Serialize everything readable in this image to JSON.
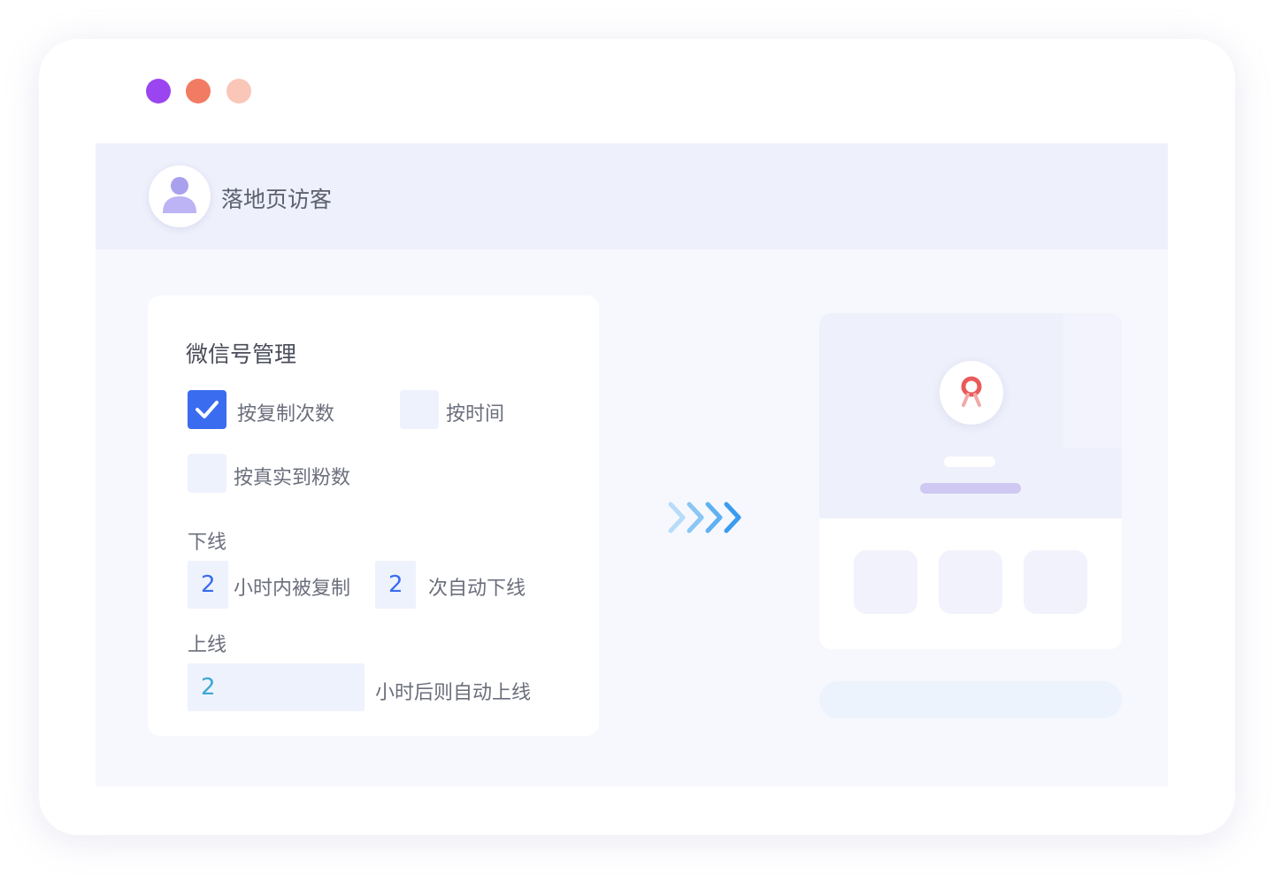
{
  "window": {
    "dots": [
      {
        "name": "dot-purple",
        "color": "#9b45f0"
      },
      {
        "name": "dot-coral",
        "color": "#f27b63"
      },
      {
        "name": "dot-peach",
        "color": "#f9c6b8"
      }
    ]
  },
  "header": {
    "title": "落地页访客",
    "avatar_icon": "user-icon"
  },
  "card": {
    "title": "微信号管理",
    "options": [
      {
        "label": "按复制次数",
        "checked": true
      },
      {
        "label": "按时间",
        "checked": false
      },
      {
        "label": "按真实到粉数",
        "checked": false
      }
    ],
    "offline": {
      "heading": "下线",
      "hours_value": "2",
      "hours_text": "小时内被复制",
      "times_value": "2",
      "times_text": "次自动下线"
    },
    "online": {
      "heading": "上线",
      "hours_value": "2",
      "hours_text": "小时后则自动上线"
    }
  },
  "flow": {
    "arrow_icon": "chevrons-right-icon",
    "accent": "#3aa7f0"
  },
  "preview": {
    "pin_icon": "location-pin-icon",
    "pin_color": "#ea5a5a"
  },
  "colors": {
    "primary": "#3a6cf0",
    "panel": "#f7f8fd",
    "header": "#eef0fb"
  }
}
